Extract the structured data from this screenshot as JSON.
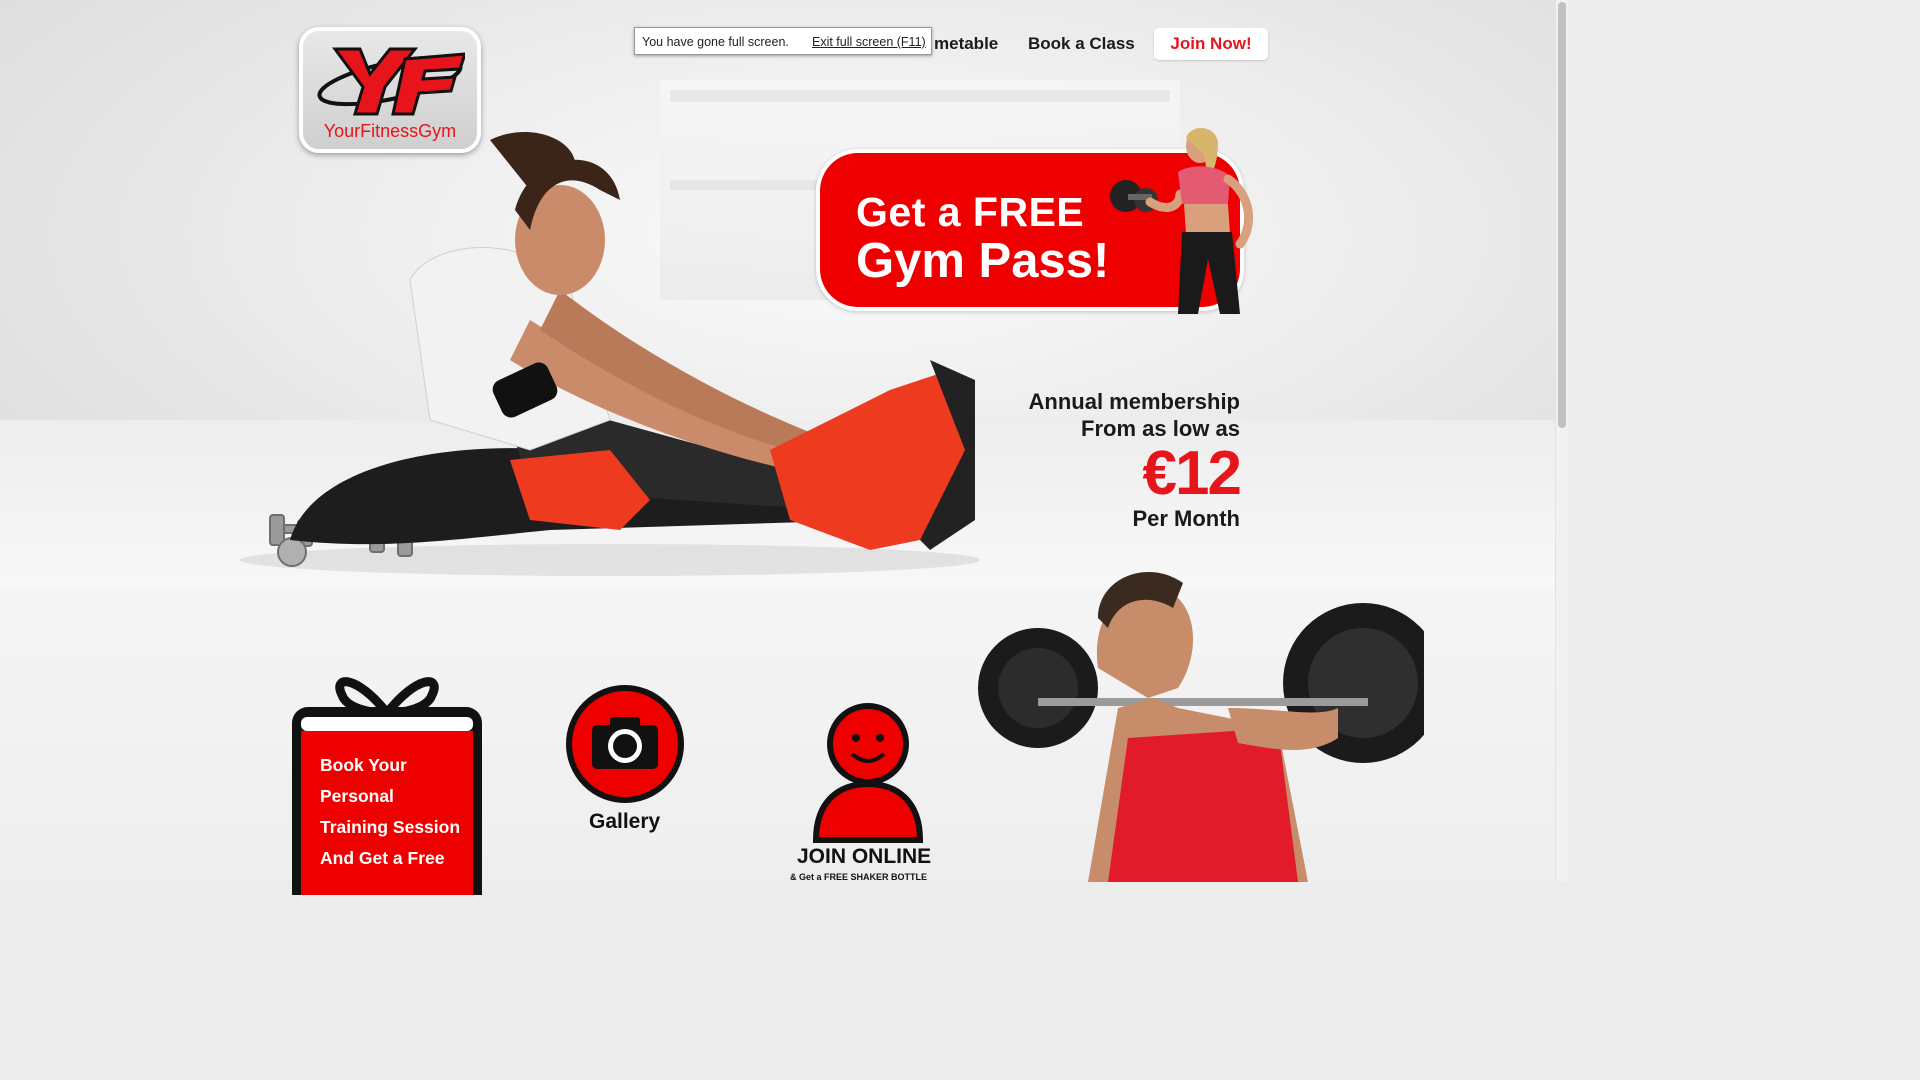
{
  "browser": {
    "fullscreen_message": "You have gone full screen.",
    "exit_fullscreen_link": "Exit full screen (F11)"
  },
  "logo": {
    "text": "YourFitnessGym",
    "mark": "YF"
  },
  "nav": {
    "items": [
      {
        "label": "metable"
      },
      {
        "label": "Book a Class"
      }
    ],
    "join_button": "Join Now!"
  },
  "promo": {
    "line1": "Get a FREE",
    "line2": "Gym Pass!"
  },
  "membership": {
    "line1": "Annual membership",
    "line2": "From as low as",
    "price": "€12",
    "per": "Per Month"
  },
  "features": {
    "gift": {
      "lines": [
        "Book Your",
        "Personal",
        "Training Session",
        "And Get a Free"
      ]
    },
    "gallery": {
      "label": "Gallery"
    },
    "join": {
      "label": "JOIN ONLINE",
      "sublabel": "& Get a FREE SHAKER BOTTLE"
    }
  },
  "colors": {
    "brand_red": "#e8141b",
    "promo_red": "#ee0000",
    "text_dark": "#1b1b1b"
  },
  "icons": [
    "camera-icon",
    "person-icon",
    "gift-icon"
  ]
}
